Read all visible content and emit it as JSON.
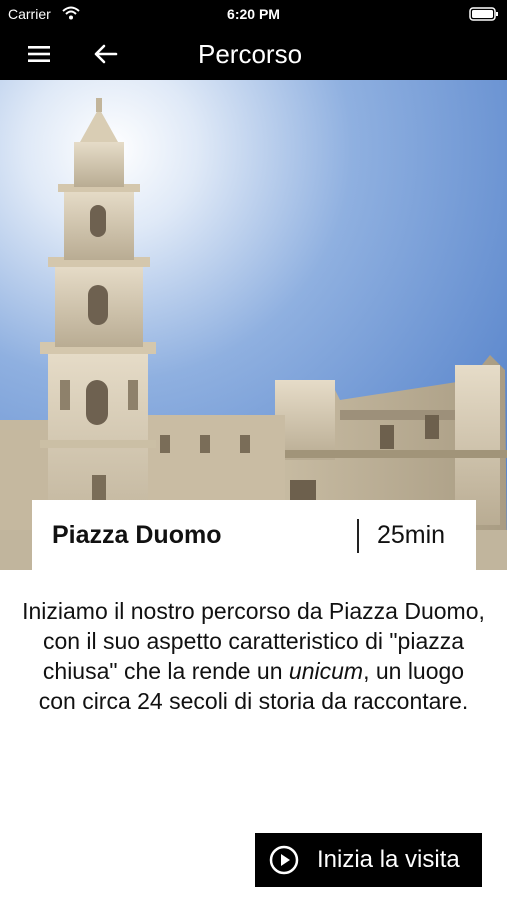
{
  "status_bar": {
    "carrier": "Carrier",
    "time": "6:20 PM"
  },
  "navbar": {
    "title": "Percorso",
    "menu_icon": "menu-icon",
    "back_icon": "back-arrow-icon"
  },
  "hero": {
    "image": "lecce-cathedral-bell-tower-photo",
    "sky_color": "#6f97d6"
  },
  "card": {
    "place_name": "Piazza Duomo",
    "duration": "25min"
  },
  "description": {
    "before": "Iniziamo il nostro percorso da Piazza Duomo, con il suo aspetto caratteristico di \"piazza chiusa\" che la rende un ",
    "italic": "unicum",
    "after": ", un luogo con circa 24 secoli di storia da raccontare."
  },
  "button": {
    "label": "Inizia la visita",
    "icon": "play-circle-icon"
  },
  "colors": {
    "bar": "#000000",
    "text": "#111111",
    "stone": "#d8cdb8"
  }
}
